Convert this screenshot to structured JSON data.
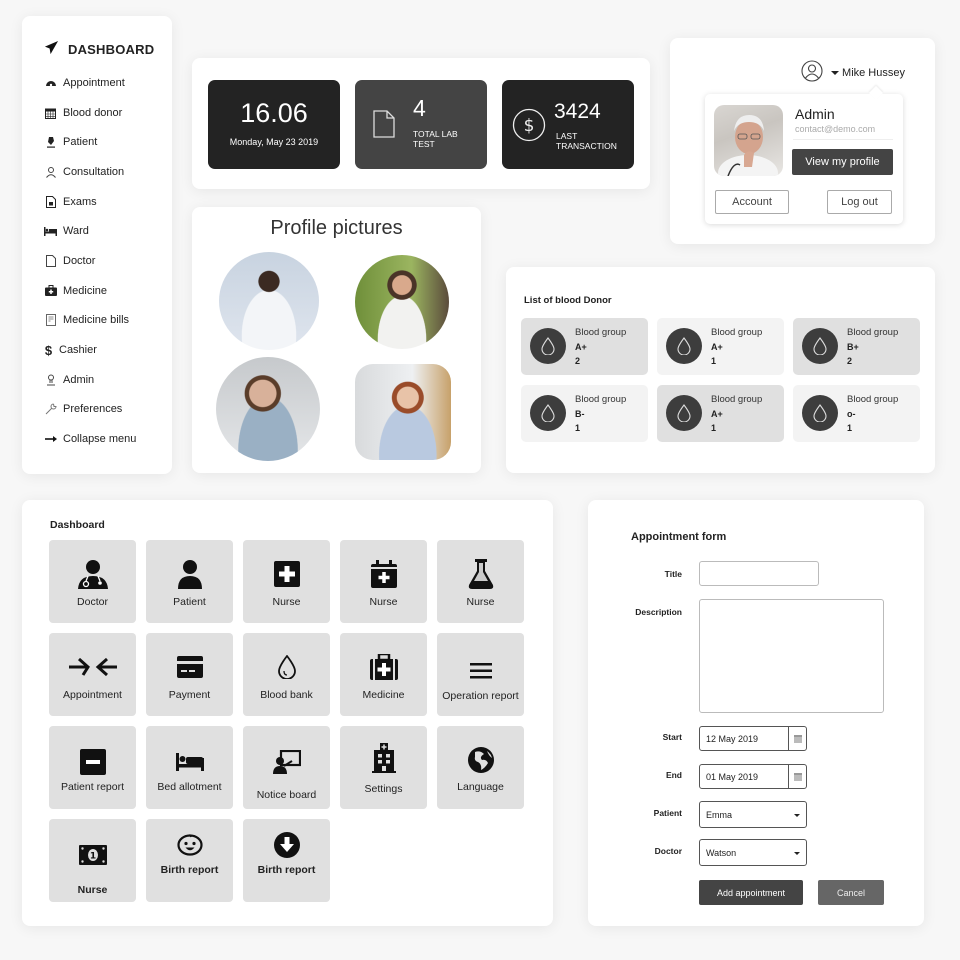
{
  "sidebar": {
    "title": "DASHBOARD",
    "items": [
      {
        "label": "Appointment",
        "icon": "dashboard-gauge-icon"
      },
      {
        "label": "Blood donor",
        "icon": "calendar-icon"
      },
      {
        "label": "Patient",
        "icon": "fire-extinguisher-icon"
      },
      {
        "label": "Consultation",
        "icon": "user-icon"
      },
      {
        "label": "Exams",
        "icon": "document-icon"
      },
      {
        "label": "Ward",
        "icon": "bed-icon"
      },
      {
        "label": "Doctor",
        "icon": "file-icon"
      },
      {
        "label": "Medicine",
        "icon": "medkit-icon"
      },
      {
        "label": "Medicine bills",
        "icon": "bill-icon"
      },
      {
        "label": "Cashier",
        "icon": "dollar-icon"
      },
      {
        "label": "Admin",
        "icon": "admin-user-icon"
      },
      {
        "label": "Preferences",
        "icon": "wrench-icon"
      },
      {
        "label": "Collapse menu",
        "icon": "arrow-right-icon"
      }
    ]
  },
  "stats": {
    "time": "16.06",
    "date": "Monday, May 23 2019",
    "lab_count": "4",
    "lab_label": "TOTAL LAB TEST",
    "transaction": "3424",
    "transaction_label": "LAST TRANSACTION"
  },
  "profile": {
    "username": "Mike Hussey",
    "role": "Admin",
    "email": "contact@demo.com",
    "view_profile": "View my profile",
    "account": "Account",
    "logout": "Log out"
  },
  "pictures": {
    "title": "Profile pictures"
  },
  "donors": {
    "title": "List of blood Donor",
    "items": [
      {
        "label": "Blood group",
        "group": "A+",
        "count": "2",
        "shade": "dark"
      },
      {
        "label": "Blood group",
        "group": "A+",
        "count": "1",
        "shade": "light"
      },
      {
        "label": "Blood group",
        "group": "B+",
        "count": "2",
        "shade": "dark"
      },
      {
        "label": "Blood group",
        "group": "B-",
        "count": "1",
        "shade": "light"
      },
      {
        "label": "Blood group",
        "group": "A+",
        "count": "1",
        "shade": "dark"
      },
      {
        "label": "Blood group",
        "group": "o-",
        "count": "1",
        "shade": "light"
      }
    ]
  },
  "dashboard": {
    "title": "Dashboard",
    "tiles": [
      {
        "label": "Doctor",
        "icon": "doctor-icon"
      },
      {
        "label": "Patient",
        "icon": "patient-icon"
      },
      {
        "label": "Nurse",
        "icon": "plus-square-icon"
      },
      {
        "label": "Nurse",
        "icon": "calendar-plus-icon"
      },
      {
        "label": "Nurse",
        "icon": "flask-icon"
      },
      {
        "label": "Appointment",
        "icon": "arrows-converge-icon"
      },
      {
        "label": "Payment",
        "icon": "credit-card-icon"
      },
      {
        "label": "Blood bank",
        "icon": "blood-drop-icon"
      },
      {
        "label": "Medicine",
        "icon": "medkit-icon"
      },
      {
        "label": "Operation report",
        "icon": "menu-lines-icon"
      },
      {
        "label": "Patient report",
        "icon": "minus-square-icon"
      },
      {
        "label": "Bed allotment",
        "icon": "bed-icon"
      },
      {
        "label": "Notice board",
        "icon": "presentation-icon"
      },
      {
        "label": "Settings",
        "icon": "hospital-icon"
      },
      {
        "label": "Language",
        "icon": "globe-icon"
      },
      {
        "label": "Nurse",
        "icon": "money-bill-icon"
      },
      {
        "label": "Birth report",
        "icon": "baby-face-icon"
      },
      {
        "label": "Birth report",
        "icon": "download-circle-icon"
      }
    ]
  },
  "form": {
    "title": "Appointment form",
    "title_label": "Title",
    "title_value": "",
    "description_label": "Description",
    "description_value": "",
    "start_label": "Start",
    "start_value": "12 May 2019",
    "end_label": "End",
    "end_value": "01 May 2019",
    "patient_label": "Patient",
    "patient_value": "Emma",
    "doctor_label": "Doctor",
    "doctor_value": "Watson",
    "add_button": "Add appointment",
    "cancel_button": "Cancel"
  }
}
